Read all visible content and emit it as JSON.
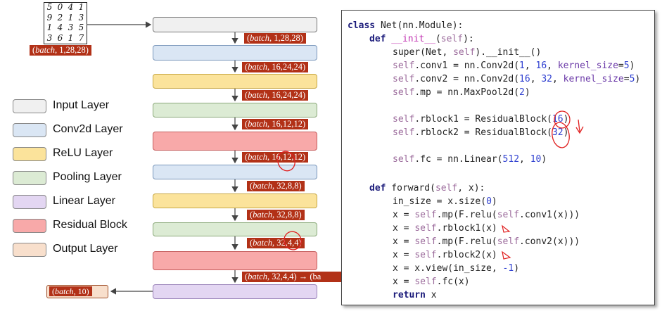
{
  "input_image": {
    "digits": [
      "5",
      "0",
      "4",
      "1",
      "9",
      "2",
      "1",
      "3",
      "1",
      "4",
      "3",
      "5",
      "3",
      "6",
      "1",
      "7"
    ]
  },
  "shape_tags": {
    "input": "(batch, 1,28,28)",
    "t1": "(batch, 1,28,28)",
    "t2": "(batch, 16,24,24)",
    "t3": "(batch, 16,24,24)",
    "t4": "(batch, 16,12,12)",
    "t5": "(batch, 16,12,12)",
    "t6": "(batch, 32,8,8)",
    "t7": "(batch, 32,8,8)",
    "t8": "(batch, 32,4,4)",
    "t9": "(batch, 32,4,4) → (ba",
    "output": "(batch, 10)"
  },
  "legend": [
    {
      "label": "Input Layer",
      "color": "#f0f0f0"
    },
    {
      "label": "Conv2d Layer",
      "color": "#dae6f4"
    },
    {
      "label": "ReLU Layer",
      "color": "#fbe39b"
    },
    {
      "label": "Pooling Layer",
      "color": "#dcebd4"
    },
    {
      "label": "Linear Layer",
      "color": "#e3d6f2"
    },
    {
      "label": "Residual Block",
      "color": "#f8a9a9"
    },
    {
      "label": "Output Layer",
      "color": "#f8dfcc"
    }
  ],
  "code": {
    "class_def": "class",
    "class_name": " Net(nn.Module):",
    "init_def": "def",
    "init_name": " __init__",
    "init_args_open": "(",
    "init_self": "self",
    "init_args_close": "):",
    "super_call": "super(Net, ",
    "super_self": "self",
    "super_rest": ").__init__()",
    "conv1_self": "self",
    "conv1_rest": ".conv1 = nn.Conv2d(",
    "conv1_a": "1",
    "conv1_b": "16",
    "conv1_kw": "kernel_size",
    "conv1_k": "5",
    "conv2_self": "self",
    "conv2_rest": ".conv2 = nn.Conv2d(",
    "conv2_a": "16",
    "conv2_b": "32",
    "conv2_kw": "kernel_size",
    "conv2_k": "5",
    "mp_self": "self",
    "mp_rest": ".mp = nn.MaxPool2d(",
    "mp_k": "2",
    "rb1_self": "self",
    "rb1_rest": ".rblock1 = ResidualBlock(",
    "rb1_n": "16",
    "rb2_self": "self",
    "rb2_rest": ".rblock2 = ResidualBlock(",
    "rb2_n": "32",
    "fc_self": "self",
    "fc_rest": ".fc = nn.Linear(",
    "fc_in": "512",
    "fc_out": "10",
    "fwd_def": "def",
    "fwd_name": " forward(",
    "fwd_self": "self",
    "fwd_rest": ", x):",
    "l1": "in_size = x.size(",
    "l1_n": "0",
    "l2_a": "x = ",
    "l2_self": "self",
    "l2_b": ".mp(F.relu(",
    "l2_self2": "self",
    "l2_c": ".conv1(x)))",
    "l3_a": "x = ",
    "l3_self": "self",
    "l3_b": ".rblock1(x)",
    "l4_a": "x = ",
    "l4_self": "self",
    "l4_b": ".mp(F.relu(",
    "l4_self2": "self",
    "l4_c": ".conv2(x)))",
    "l5_a": "x = ",
    "l5_self": "self",
    "l5_b": ".rblock2(x)",
    "l6": "x = x.view(in_size, ",
    "l6_n": "-1",
    "l6_end": ")",
    "l7_a": "x = ",
    "l7_self": "self",
    "l7_b": ".fc(x)",
    "ret": "return",
    "ret_val": " x"
  },
  "colors": {
    "tag_bg": "#b23117",
    "annotation_red": "#e02020"
  }
}
